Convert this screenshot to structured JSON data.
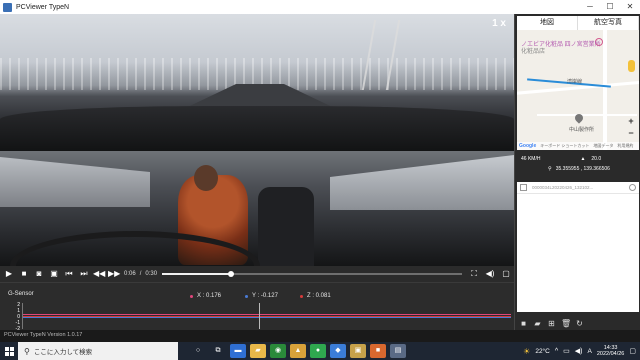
{
  "window": {
    "title": "PCViewer TypeN",
    "controls": [
      "─",
      "☐",
      "✕"
    ]
  },
  "video": {
    "speed_indicator": "1 x"
  },
  "player": {
    "current_time": "0:06",
    "separator": "/",
    "total_time": "0:30",
    "progress": 0.23
  },
  "gsensor": {
    "title": "G-Sensor",
    "x_label": "X : 0.176",
    "y_label": "Y : -0.127",
    "z_label": "Z : 0.081",
    "axis_ticks": [
      "2",
      "1",
      "0",
      "-1",
      "-2"
    ],
    "colors": {
      "x": "#e0457b",
      "y": "#4a7bd6",
      "z": "#d83a3a"
    }
  },
  "map": {
    "tabs": [
      "地図",
      "航空写真"
    ],
    "poi_label": "ノエビア化粧品 四ノ宮営業所",
    "poi_sub": "化粧品店",
    "place_label": "中山製作所",
    "road_label": "湾岸線",
    "footer": [
      "Google",
      "キーボード ショートカット",
      "地図データ",
      "利用規約"
    ],
    "zoom_in": "+",
    "zoom_out": "−"
  },
  "stats": {
    "speed": "46  KM/H",
    "altitude": "20.0",
    "coords": "35.355955 , 139.366506"
  },
  "files": [
    {
      "name": "0000034L20220426_132102..."
    }
  ],
  "status": {
    "version": "PCViewer TypeN Version 1.0.17"
  },
  "taskbar": {
    "search_placeholder": "ここに入力して検索",
    "temperature": "22°C",
    "ime": "A",
    "time": "14:33",
    "date": "2022/04/26"
  }
}
